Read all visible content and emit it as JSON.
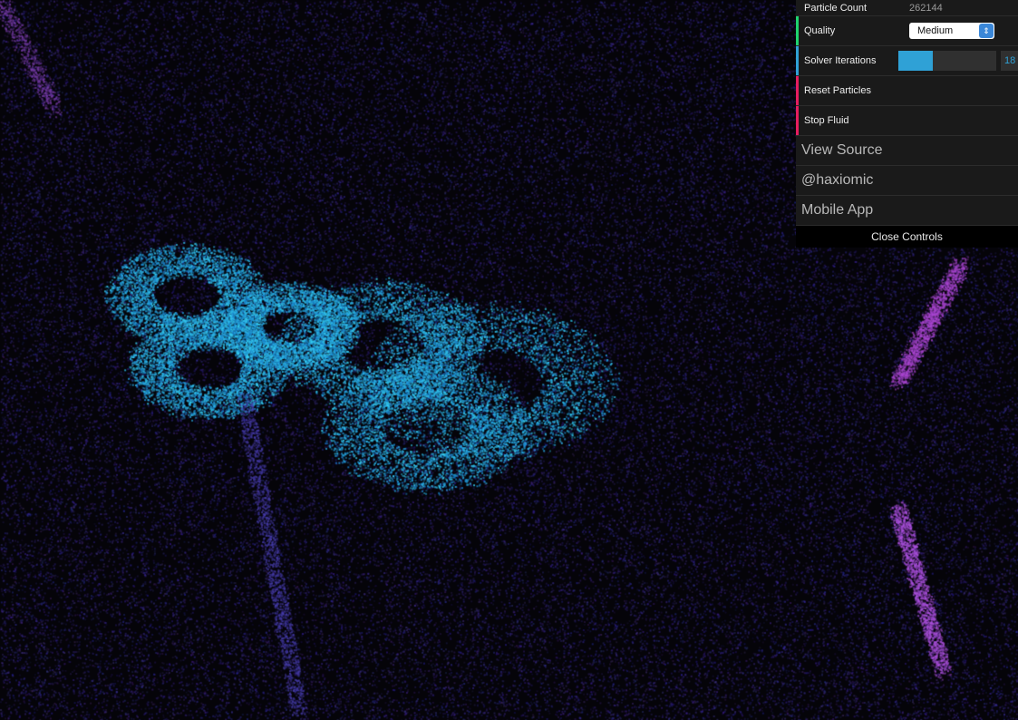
{
  "gui": {
    "particle_count_label": "Particle Count",
    "particle_count_value": "262144",
    "quality_label": "Quality",
    "quality_value": "Medium",
    "solver_iterations_label": "Solver Iterations",
    "solver_iterations_value": "18",
    "solver_iterations_fraction": 0.35,
    "reset_particles_label": "Reset Particles",
    "stop_fluid_label": "Stop Fluid",
    "links": [
      "View Source",
      "@haxiomic",
      "Mobile App"
    ],
    "close_controls_label": "Close Controls",
    "colors": {
      "quality_bar": "#1ed36f",
      "slider_bar": "#2fa1d6",
      "button_bar": "#e61d5f",
      "slider_fill": "#2fa1d6"
    }
  },
  "icons": {
    "select_arrow": "chevron-up-down-icon"
  }
}
